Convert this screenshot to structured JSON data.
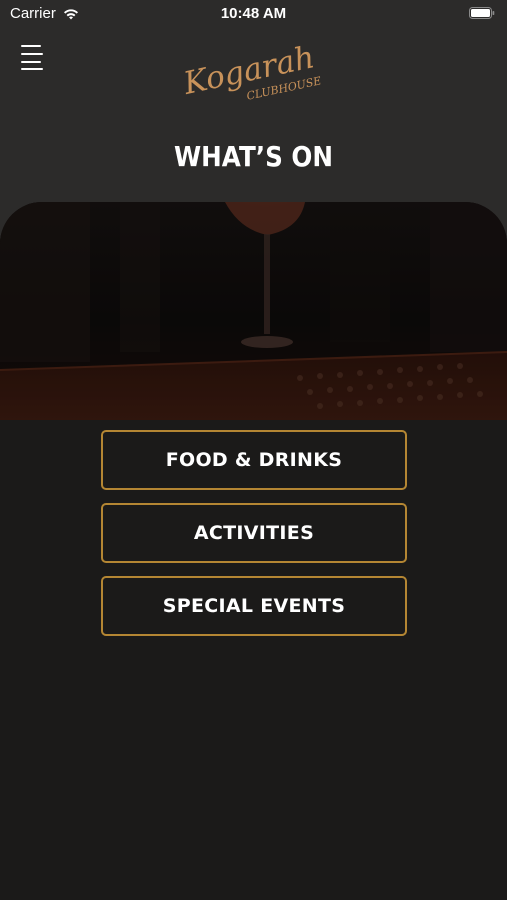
{
  "status_bar": {
    "carrier": "Carrier",
    "time": "10:48 AM",
    "wifi_icon": "wifi-icon",
    "battery_icon": "battery-icon"
  },
  "header": {
    "menu_icon": "hamburger-menu-icon",
    "logo_main": "Kogarah",
    "logo_sub": "CLUBHOUSE",
    "title": "WHAT’S ON"
  },
  "hero": {
    "image": "dimly-lit-bar-cocktail-glass-image"
  },
  "menu": {
    "items": [
      {
        "label": "FOOD & DRINKS"
      },
      {
        "label": "ACTIVITIES"
      },
      {
        "label": "SPECIAL EVENTS"
      }
    ]
  },
  "colors": {
    "accent_gold": "#b48633",
    "logo_copper": "#c8925a",
    "background_dark": "#1b1a19",
    "header_bg": "#2c2b2a"
  }
}
